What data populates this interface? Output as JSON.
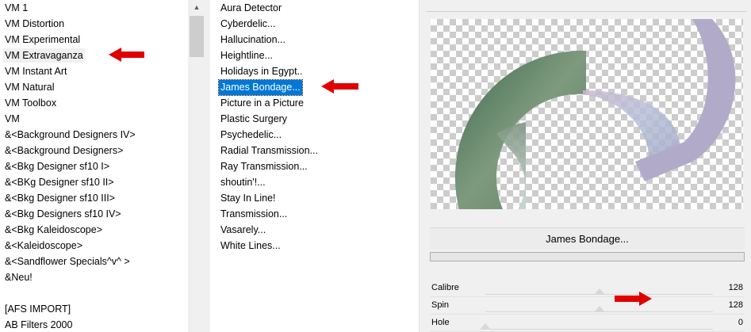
{
  "categories": {
    "items": [
      {
        "label": "VM 1",
        "highlighted": false
      },
      {
        "label": "VM Distortion",
        "highlighted": false
      },
      {
        "label": "VM Experimental",
        "highlighted": false
      },
      {
        "label": "VM Extravaganza",
        "highlighted": true
      },
      {
        "label": "VM Instant Art",
        "highlighted": false
      },
      {
        "label": "VM Natural",
        "highlighted": false
      },
      {
        "label": "VM Toolbox",
        "highlighted": false
      },
      {
        "label": "VM",
        "highlighted": false
      },
      {
        "label": "&<Background Designers IV>",
        "highlighted": false
      },
      {
        "label": "&<Background Designers>",
        "highlighted": false
      },
      {
        "label": "&<Bkg Designer sf10 I>",
        "highlighted": false
      },
      {
        "label": "&<BKg Designer sf10 II>",
        "highlighted": false
      },
      {
        "label": "&<Bkg Designer sf10 III>",
        "highlighted": false
      },
      {
        "label": "&<Bkg Designers sf10 IV>",
        "highlighted": false
      },
      {
        "label": "&<Bkg Kaleidoscope>",
        "highlighted": false
      },
      {
        "label": "&<Kaleidoscope>",
        "highlighted": false
      },
      {
        "label": "&<Sandflower Specials^v^ >",
        "highlighted": false
      },
      {
        "label": "&Neu!",
        "highlighted": false
      },
      {
        "label": "",
        "highlighted": false
      },
      {
        "label": "[AFS IMPORT]",
        "highlighted": false
      },
      {
        "label": "AB Filters 2000",
        "highlighted": false
      }
    ],
    "scroll_up_icon": "triangle-up-icon"
  },
  "filters": {
    "items": [
      {
        "label": "Aura Detector",
        "selected": false
      },
      {
        "label": "Cyberdelic...",
        "selected": false
      },
      {
        "label": "Hallucination...",
        "selected": false
      },
      {
        "label": "Heightline...",
        "selected": false
      },
      {
        "label": "Holidays in Egypt..",
        "selected": false
      },
      {
        "label": "James Bondage...",
        "selected": true
      },
      {
        "label": "Picture in a Picture",
        "selected": false
      },
      {
        "label": "Plastic Surgery",
        "selected": false
      },
      {
        "label": "Psychedelic...",
        "selected": false
      },
      {
        "label": "Radial Transmission...",
        "selected": false
      },
      {
        "label": "Ray Transmission...",
        "selected": false
      },
      {
        "label": "shoutin'!...",
        "selected": false
      },
      {
        "label": "Stay In Line!",
        "selected": false
      },
      {
        "label": "Transmission...",
        "selected": false
      },
      {
        "label": "Vasarely...",
        "selected": false
      },
      {
        "label": "White Lines...",
        "selected": false
      }
    ]
  },
  "dialog": {
    "filter_title": "James Bondage...",
    "progress": 0,
    "params": [
      {
        "label": "Calibre",
        "value": "128",
        "level": 0.5
      },
      {
        "label": "Spin",
        "value": "128",
        "level": 0.5
      },
      {
        "label": "Hole",
        "value": "0",
        "level": 0
      }
    ]
  },
  "annotations": {
    "arrow_color": "#e00000",
    "arrow_icon": "red-arrow-left-icon"
  }
}
